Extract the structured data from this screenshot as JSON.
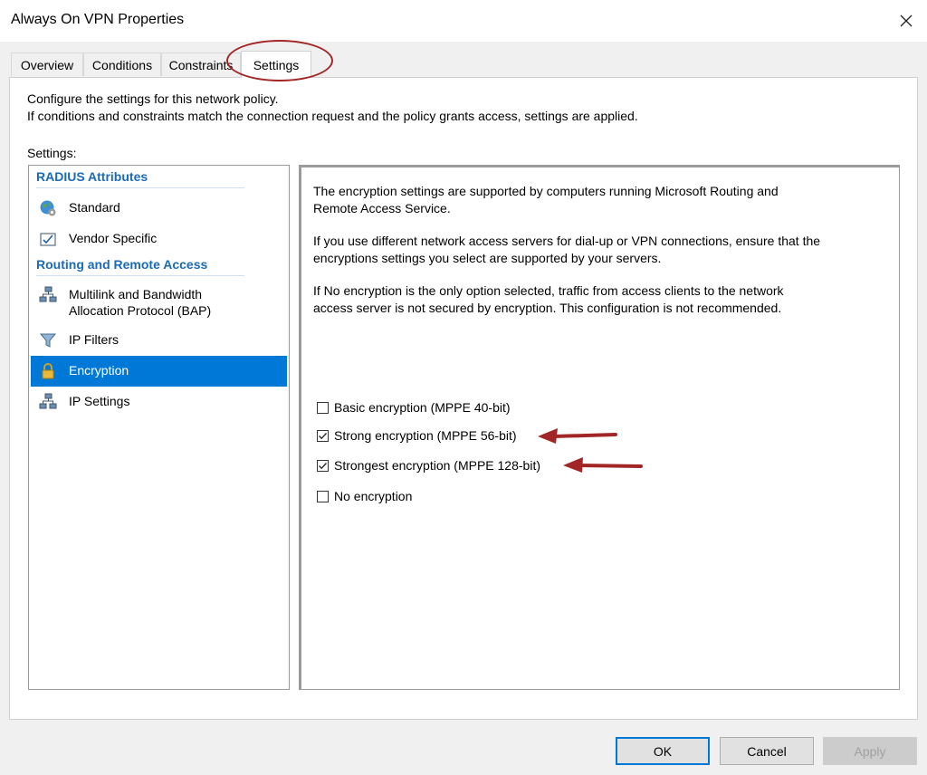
{
  "window": {
    "title": "Always On VPN Properties",
    "close_icon": "close-icon"
  },
  "tabs": [
    {
      "label": "Overview",
      "active": false
    },
    {
      "label": "Conditions",
      "active": false
    },
    {
      "label": "Constraints",
      "active": false
    },
    {
      "label": "Settings",
      "active": true
    }
  ],
  "panel": {
    "description_line1": "Configure the settings for this network policy.",
    "description_line2": "If conditions and constraints match the connection request and the policy grants access, settings are applied.",
    "settings_label": "Settings:"
  },
  "nav": {
    "groups": [
      {
        "header": "RADIUS Attributes"
      },
      {
        "header": "Routing and Remote Access"
      }
    ],
    "items": [
      {
        "label": "Standard",
        "icon": "globe-gear-icon"
      },
      {
        "label": "Vendor Specific",
        "icon": "checked-document-icon"
      },
      {
        "label_line1": "Multilink and Bandwidth",
        "label_line2": "Allocation Protocol (BAP)",
        "icon": "network-computers-icon"
      },
      {
        "label": "IP Filters",
        "icon": "funnel-icon"
      },
      {
        "label": "Encryption",
        "icon": "padlock-icon",
        "selected": true
      },
      {
        "label": "IP Settings",
        "icon": "network-computers-icon"
      }
    ]
  },
  "content": {
    "para1_line1": "The encryption settings are supported by computers running Microsoft Routing and",
    "para1_line2": "Remote Access Service.",
    "para2_line1": "If you use different network access servers for dial-up or VPN connections, ensure that the",
    "para2_line2": "encryptions settings you select are supported by your servers.",
    "para3_line1": "If No encryption is the only option selected, traffic from access clients to the network",
    "para3_line2": "access server is not secured by encryption. This configuration is not recommended.",
    "checkboxes": [
      {
        "label": "Basic encryption (MPPE 40-bit)",
        "checked": false
      },
      {
        "label": "Strong encryption (MPPE 56-bit)",
        "checked": true
      },
      {
        "label": "Strongest encryption (MPPE 128-bit)",
        "checked": true
      },
      {
        "label": "No encryption",
        "checked": false
      }
    ]
  },
  "buttons": {
    "ok": "OK",
    "cancel": "Cancel",
    "apply": "Apply"
  },
  "colors": {
    "accent": "#0078d7",
    "group_header": "#1a6bb8",
    "annotation": "#a32626"
  }
}
